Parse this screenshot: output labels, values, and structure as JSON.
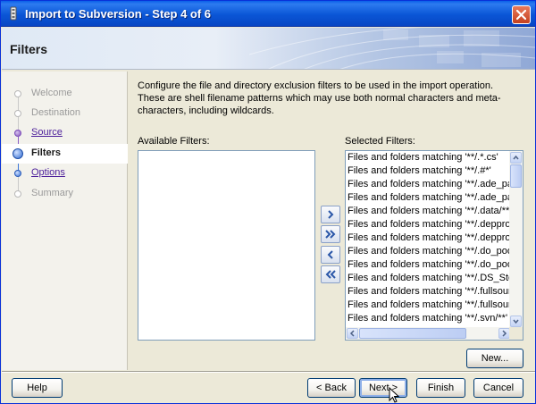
{
  "window": {
    "title": "Import to Subversion - Step 4 of 6"
  },
  "header": {
    "title": "Filters"
  },
  "steps": [
    {
      "label": "Welcome",
      "state": "disabled"
    },
    {
      "label": "Destination",
      "state": "disabled"
    },
    {
      "label": "Source",
      "state": "visited"
    },
    {
      "label": "Filters",
      "state": "current"
    },
    {
      "label": "Options",
      "state": "next"
    },
    {
      "label": "Summary",
      "state": "disabled"
    }
  ],
  "content": {
    "description": "Configure the file and directory exclusion filters to be used in the import operation. These are shell filename patterns which may use both normal characters and meta-characters, including wildcards.",
    "available_label": "Available Filters:",
    "selected_label": "Selected Filters:",
    "selected_filters": [
      "Files and folders matching '**/.*.cs'",
      "Files and folders matching '**/.#*'",
      "Files and folders matching '**/.ade_path'",
      "Files and folders matching '**/.ade_path/",
      "Files and folders matching '**/.data/**'",
      "Files and folders matching '**/.depprod'",
      "Files and folders matching '**/.depprod_r",
      "Files and folders matching '**/.do_pool'",
      "Files and folders matching '**/.do_pool/**",
      "Files and folders matching '**/.DS_Store'",
      "Files and folders matching '**/.fullsource'",
      "Files and folders matching '**/.fullsource_",
      "Files and folders matching '**/.svn/**'"
    ]
  },
  "buttons": {
    "new": "New...",
    "help": "Help",
    "back": "< Back",
    "next": "Next >",
    "finish": "Finish",
    "cancel": "Cancel"
  },
  "colors": {
    "titlebar": "#0a56d6",
    "link": "#4b1e9a",
    "current_step": "#2f6ad0"
  }
}
